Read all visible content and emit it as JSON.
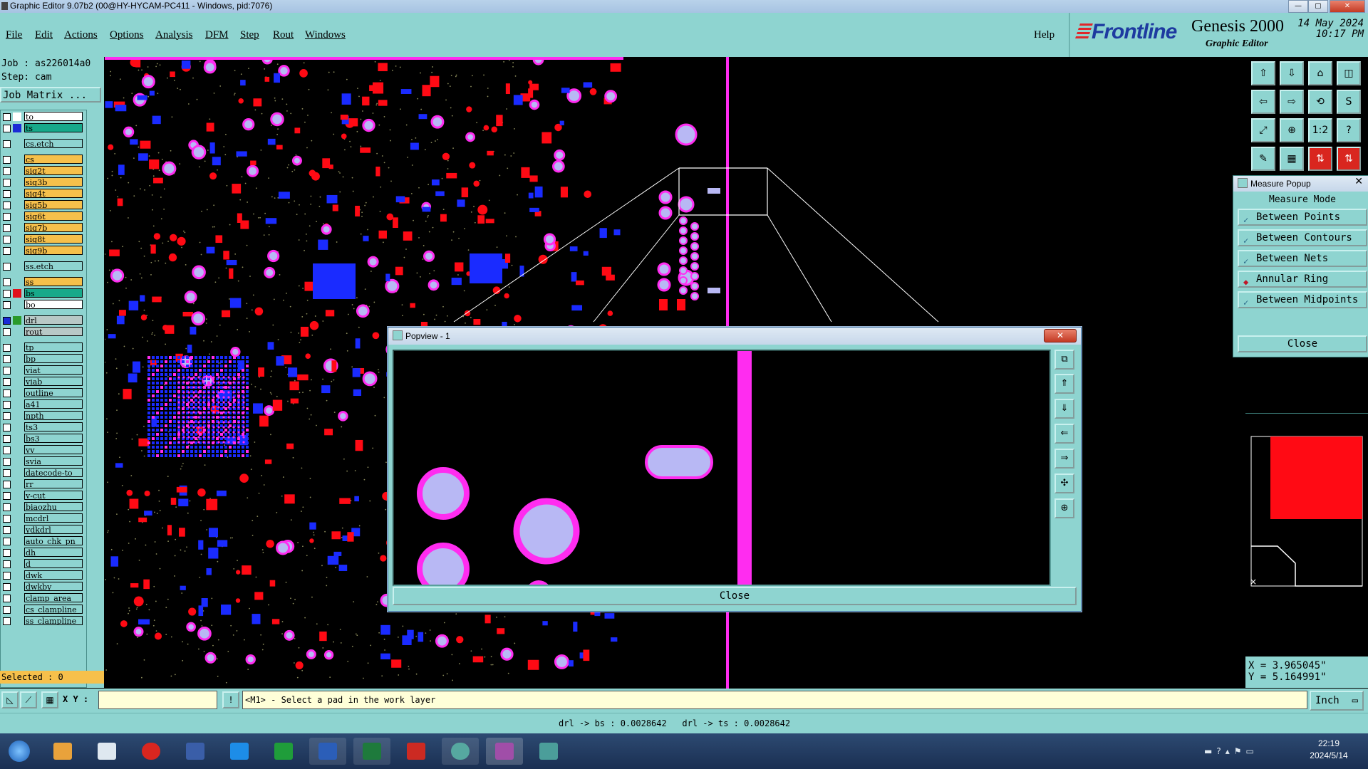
{
  "window": {
    "title": "Graphic Editor 9.07b2 (00@HY-HYCAM-PC411 - Windows, pid:7076)",
    "min": "—",
    "max": "▢",
    "close": "✕"
  },
  "menu": [
    "File",
    "Edit",
    "Actions",
    "Options",
    "Analysis",
    "DFM",
    "Step",
    "Rout",
    "Windows"
  ],
  "help": "Help",
  "logo": {
    "brand": "Frontline",
    "product": "Genesis 2000",
    "subtitle": "Graphic Editor",
    "date": "14 May 2024",
    "time": "10:17 PM"
  },
  "job": {
    "job": "Job : as226014a0",
    "step": "Step: cam",
    "matrix": "Job Matrix ..."
  },
  "layers": [
    {
      "name": "to",
      "color": "#ffffff",
      "name_bg": "#ffffff",
      "checked": false
    },
    {
      "name": "ts",
      "color": "#1a2bd6",
      "name_bg": "#17a98a",
      "checked": false
    },
    {
      "name": "cs.etch",
      "color": "",
      "name_bg": "#8ed4d0",
      "checked": false
    },
    {
      "name": "cs",
      "color": "",
      "name_bg": "#f6c04b",
      "checked": false
    },
    {
      "name": "sig2t",
      "color": "",
      "name_bg": "#f6c04b",
      "checked": false
    },
    {
      "name": "sig3b",
      "color": "",
      "name_bg": "#f6c04b",
      "checked": false
    },
    {
      "name": "sig4t",
      "color": "",
      "name_bg": "#f6c04b",
      "checked": false
    },
    {
      "name": "sig5b",
      "color": "",
      "name_bg": "#f6c04b",
      "checked": false
    },
    {
      "name": "sig6t",
      "color": "",
      "name_bg": "#f6c04b",
      "checked": false
    },
    {
      "name": "sig7b",
      "color": "",
      "name_bg": "#f6c04b",
      "checked": false
    },
    {
      "name": "sig8t",
      "color": "",
      "name_bg": "#f6c04b",
      "checked": false
    },
    {
      "name": "sig9b",
      "color": "",
      "name_bg": "#f6c04b",
      "checked": false
    },
    {
      "name": "ss.etch",
      "color": "",
      "name_bg": "#8ed4d0",
      "checked": false
    },
    {
      "name": "ss",
      "color": "",
      "name_bg": "#f6c04b",
      "checked": false
    },
    {
      "name": "bs",
      "color": "#e0101a",
      "name_bg": "#17a98a",
      "checked": false
    },
    {
      "name": "bo",
      "color": "",
      "name_bg": "#ffffff",
      "checked": false
    },
    {
      "name": "drl",
      "color": "#2a9a2a",
      "name_bg": "#b8c8c6",
      "checked": true
    },
    {
      "name": "rout",
      "color": "",
      "name_bg": "#b8c8c6",
      "checked": false
    },
    {
      "name": "tp",
      "color": "",
      "name_bg": "#8ed4d0",
      "checked": false
    },
    {
      "name": "bp",
      "color": "",
      "name_bg": "#8ed4d0",
      "checked": false
    },
    {
      "name": "viat",
      "color": "",
      "name_bg": "#8ed4d0",
      "checked": false
    },
    {
      "name": "viab",
      "color": "",
      "name_bg": "#8ed4d0",
      "checked": false
    },
    {
      "name": "outline",
      "color": "",
      "name_bg": "#8ed4d0",
      "checked": false
    },
    {
      "name": "a41",
      "color": "",
      "name_bg": "#8ed4d0",
      "checked": false
    },
    {
      "name": "npth",
      "color": "",
      "name_bg": "#8ed4d0",
      "checked": false
    },
    {
      "name": "ts3",
      "color": "",
      "name_bg": "#8ed4d0",
      "checked": false
    },
    {
      "name": "bs3",
      "color": "",
      "name_bg": "#8ed4d0",
      "checked": false
    },
    {
      "name": "vv",
      "color": "",
      "name_bg": "#8ed4d0",
      "checked": false
    },
    {
      "name": "svia",
      "color": "",
      "name_bg": "#8ed4d0",
      "checked": false
    },
    {
      "name": "datecode-to",
      "color": "",
      "name_bg": "#8ed4d0",
      "checked": false
    },
    {
      "name": "rr",
      "color": "",
      "name_bg": "#8ed4d0",
      "checked": false
    },
    {
      "name": "v-cut",
      "color": "",
      "name_bg": "#8ed4d0",
      "checked": false
    },
    {
      "name": "biaozhu",
      "color": "",
      "name_bg": "#8ed4d0",
      "checked": false
    },
    {
      "name": "mcdrl",
      "color": "",
      "name_bg": "#8ed4d0",
      "checked": false
    },
    {
      "name": "ydkdrl",
      "color": "",
      "name_bg": "#8ed4d0",
      "checked": false
    },
    {
      "name": "auto_chk_pn",
      "color": "",
      "name_bg": "#8ed4d0",
      "checked": false
    },
    {
      "name": "dh",
      "color": "",
      "name_bg": "#8ed4d0",
      "checked": false
    },
    {
      "name": "d",
      "color": "",
      "name_bg": "#8ed4d0",
      "checked": false
    },
    {
      "name": "dwk",
      "color": "",
      "name_bg": "#8ed4d0",
      "checked": false
    },
    {
      "name": "dwkby",
      "color": "",
      "name_bg": "#8ed4d0",
      "checked": false
    },
    {
      "name": "clamp_area",
      "color": "",
      "name_bg": "#8ed4d0",
      "checked": false
    },
    {
      "name": "cs_clampline",
      "color": "",
      "name_bg": "#8ed4d0",
      "checked": false
    },
    {
      "name": "ss_clampline",
      "color": "",
      "name_bg": "#8ed4d0",
      "checked": false
    }
  ],
  "selected": "Selected : 0",
  "measure": {
    "title": "Measure Popup",
    "mode_label": "Measure Mode",
    "options": [
      {
        "label": "Between Points",
        "active": false
      },
      {
        "label": "Between Contours",
        "active": false
      },
      {
        "label": "Between Nets",
        "active": false
      },
      {
        "label": "Annular Ring",
        "active": true
      },
      {
        "label": "Between Midpoints",
        "active": false
      }
    ],
    "close": "Close"
  },
  "popview": {
    "title": "Popview - 1",
    "close": "Close"
  },
  "coords": {
    "x": "X = 3.965045\"",
    "y": "Y = 5.164991\""
  },
  "cmd": {
    "xy_label": "X Y :",
    "xy_value": "",
    "prompt": "<M1> - Select a pad in the work layer",
    "units": "Inch"
  },
  "status": "drl -> bs : 0.0028642   drl -> ts : 0.0028642",
  "clock": {
    "time": "22:19",
    "date": "2024/5/14"
  },
  "colors": {
    "panel": "#8ed4d0",
    "pad_red": "#ff0a14",
    "pad_blue": "#1a2bff",
    "pad_magenta": "#ff2cf0",
    "pad_lavender": "#b8b8f4",
    "active_layer": "#f6c04b"
  }
}
